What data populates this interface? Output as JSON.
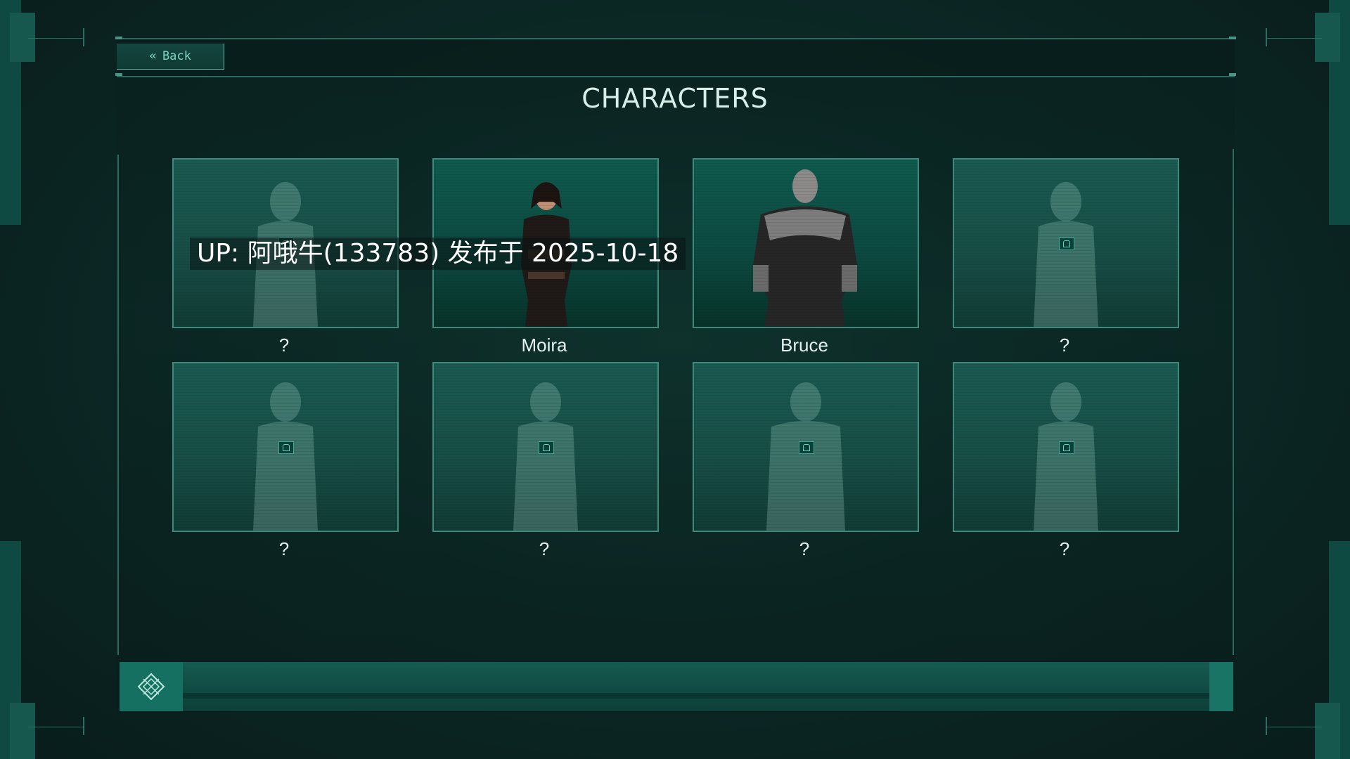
{
  "header": {
    "back_label": "Back",
    "back_icon": "double-chevron-left-icon",
    "title": "CHARACTERS"
  },
  "characters": [
    {
      "name": "?",
      "locked": true
    },
    {
      "name": "Moira",
      "locked": false
    },
    {
      "name": "Bruce",
      "locked": false
    },
    {
      "name": "?",
      "locked": true
    },
    {
      "name": "?",
      "locked": true
    },
    {
      "name": "?",
      "locked": true
    },
    {
      "name": "?",
      "locked": true
    },
    {
      "name": "?",
      "locked": true
    }
  ],
  "watermark": "UP: 阿哦牛(133783) 发布于 2025-10-18",
  "footer": {
    "logo_icon": "diamond-crosshatch-icon"
  },
  "colors": {
    "accent": "#3c8a7c",
    "text": "#d8efe9",
    "back_text": "#7fd4c1"
  }
}
